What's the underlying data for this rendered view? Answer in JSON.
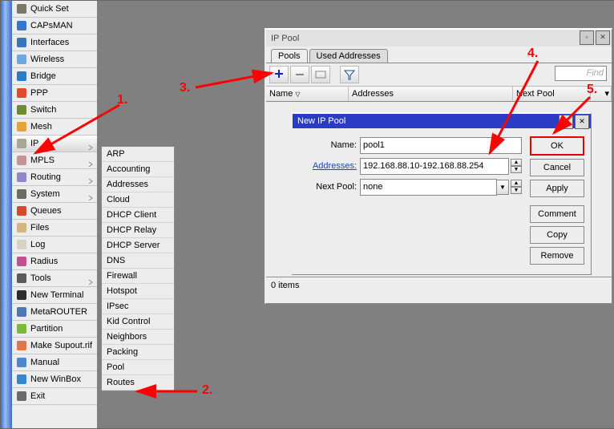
{
  "sidebar": {
    "items": [
      {
        "label": "Quick Set",
        "icon": "wrench"
      },
      {
        "label": "CAPsMAN",
        "icon": "antenna"
      },
      {
        "label": "Interfaces",
        "icon": "interfaces"
      },
      {
        "label": "Wireless",
        "icon": "wifi"
      },
      {
        "label": "Bridge",
        "icon": "bridge"
      },
      {
        "label": "PPP",
        "icon": "ppp"
      },
      {
        "label": "Switch",
        "icon": "switch"
      },
      {
        "label": "Mesh",
        "icon": "mesh"
      },
      {
        "label": "IP",
        "icon": "ip-badge",
        "has_sub": true,
        "selected": true
      },
      {
        "label": "MPLS",
        "icon": "mpls",
        "has_sub": true
      },
      {
        "label": "Routing",
        "icon": "routing",
        "has_sub": true
      },
      {
        "label": "System",
        "icon": "system",
        "has_sub": true
      },
      {
        "label": "Queues",
        "icon": "queue"
      },
      {
        "label": "Files",
        "icon": "files"
      },
      {
        "label": "Log",
        "icon": "log"
      },
      {
        "label": "Radius",
        "icon": "radius"
      },
      {
        "label": "Tools",
        "icon": "tools",
        "has_sub": true
      },
      {
        "label": "New Terminal",
        "icon": "terminal"
      },
      {
        "label": "MetaROUTER",
        "icon": "router"
      },
      {
        "label": "Partition",
        "icon": "partition"
      },
      {
        "label": "Make Supout.rif",
        "icon": "makefile"
      },
      {
        "label": "Manual",
        "icon": "manual"
      },
      {
        "label": "New WinBox",
        "icon": "winbox"
      },
      {
        "label": "Exit",
        "icon": "exit"
      }
    ]
  },
  "submenu": [
    "ARP",
    "Accounting",
    "Addresses",
    "Cloud",
    "DHCP Client",
    "DHCP Relay",
    "DHCP Server",
    "DNS",
    "Firewall",
    "Hotspot",
    "IPsec",
    "Kid Control",
    "Neighbors",
    "Packing",
    "Pool",
    "Routes"
  ],
  "ip_pool": {
    "title": "IP Pool",
    "tabs": [
      "Pools",
      "Used Addresses"
    ],
    "find": "Find",
    "columns": [
      "Name",
      "Addresses",
      "Next Pool"
    ],
    "status": "0 items"
  },
  "new_pool": {
    "title": "New IP Pool",
    "name_label": "Name:",
    "name_value": "pool1",
    "addresses_label": "Addresses:",
    "addresses_value": "192.168.88.10-192.168.88.254",
    "next_pool_label": "Next Pool:",
    "next_pool_value": "none",
    "buttons": {
      "ok": "OK",
      "cancel": "Cancel",
      "apply": "Apply",
      "comment": "Comment",
      "copy": "Copy",
      "remove": "Remove"
    }
  },
  "annotations": {
    "n1": "1.",
    "n2": "2.",
    "n3": "3.",
    "n4": "4.",
    "n5": "5."
  }
}
